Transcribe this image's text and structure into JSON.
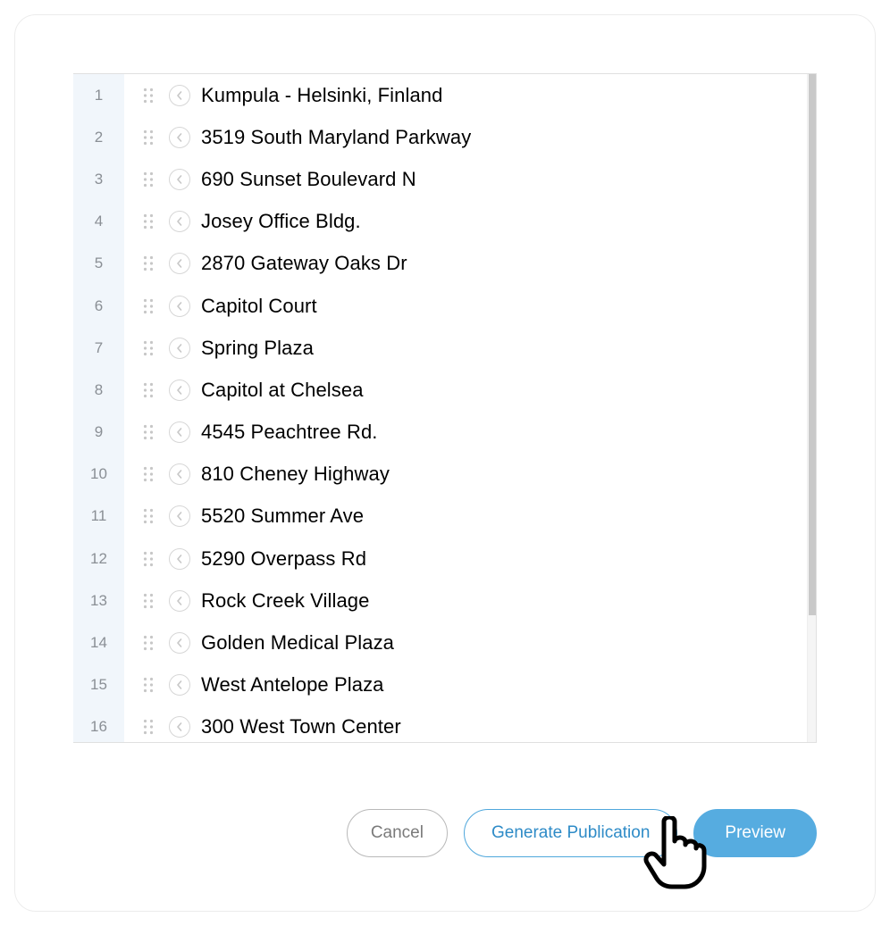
{
  "list": {
    "items": [
      {
        "n": "1",
        "label": "Kumpula - Helsinki, Finland"
      },
      {
        "n": "2",
        "label": "3519 South Maryland Parkway"
      },
      {
        "n": "3",
        "label": "690 Sunset Boulevard N"
      },
      {
        "n": "4",
        "label": "Josey Office Bldg."
      },
      {
        "n": "5",
        "label": "2870 Gateway Oaks Dr"
      },
      {
        "n": "6",
        "label": "Capitol Court"
      },
      {
        "n": "7",
        "label": "Spring Plaza"
      },
      {
        "n": "8",
        "label": "Capitol at Chelsea"
      },
      {
        "n": "9",
        "label": "4545 Peachtree Rd."
      },
      {
        "n": "10",
        "label": "810 Cheney Highway"
      },
      {
        "n": "11",
        "label": "5520 Summer Ave"
      },
      {
        "n": "12",
        "label": "5290 Overpass Rd"
      },
      {
        "n": "13",
        "label": "Rock Creek Village"
      },
      {
        "n": "14",
        "label": "Golden Medical Plaza"
      },
      {
        "n": "15",
        "label": "West Antelope Plaza"
      },
      {
        "n": "16",
        "label": "300 West Town Center"
      }
    ]
  },
  "buttons": {
    "cancel": "Cancel",
    "generate": "Generate Publication",
    "preview": "Preview"
  },
  "colors": {
    "accent": "#56ace0",
    "gutter_bg": "#f1f6fb",
    "border": "#e0e0e0"
  }
}
